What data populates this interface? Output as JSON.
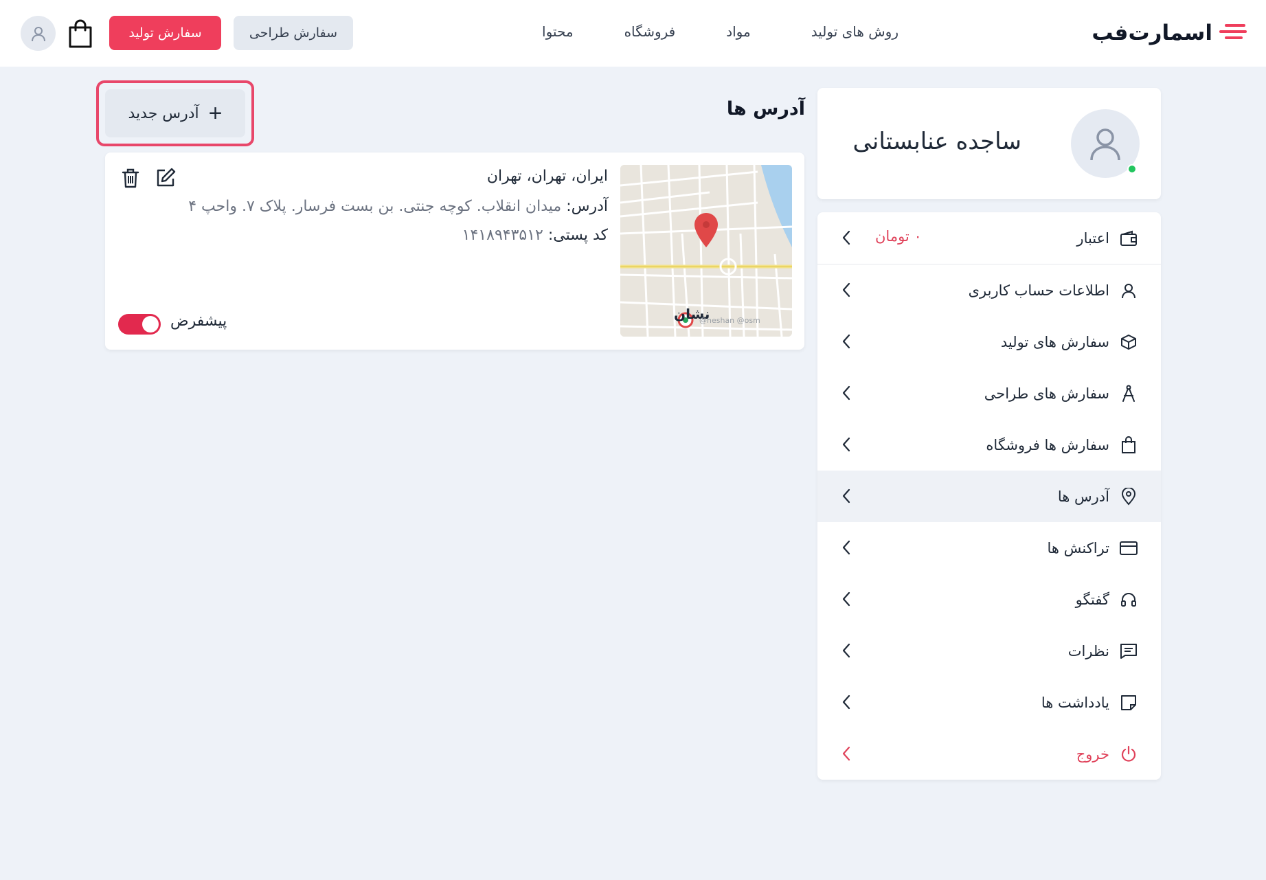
{
  "header": {
    "logo_text": "اسمارت‌فب",
    "nav": [
      "روش های تولید",
      "مواد",
      "فروشگاه",
      "محتوا"
    ],
    "design_order_button": "سفارش طراحی",
    "production_order_button": "سفارش تولید"
  },
  "profile": {
    "name": "ساجده عنابستانی"
  },
  "menu": {
    "credit": {
      "label": "اعتبار",
      "value": "۰ تومان"
    },
    "items": [
      {
        "label": "اطلاعات حساب کاربری",
        "icon": "user-icon"
      },
      {
        "label": "سفارش های تولید",
        "icon": "box-icon"
      },
      {
        "label": "سفارش های طراحی",
        "icon": "compass-icon"
      },
      {
        "label": "سفارش ها فروشگاه",
        "icon": "shopping-bag-icon"
      },
      {
        "label": "آدرس ها",
        "icon": "location-pin-icon"
      },
      {
        "label": "تراکنش ها",
        "icon": "credit-card-icon"
      },
      {
        "label": "گفتگو",
        "icon": "headset-icon"
      },
      {
        "label": "نظرات",
        "icon": "comment-icon"
      },
      {
        "label": "یادداشت ها",
        "icon": "note-icon"
      }
    ],
    "logout": "خروج"
  },
  "main": {
    "title": "آدرس ها",
    "new_address_button": "آدرس جدید",
    "address": {
      "city_line": "ایران، تهران، تهران",
      "address_label": "آدرس:",
      "address_value": "میدان انقلاب. کوچه جنتی. بن بست فرسار. پلاک ۷. واحپ ۴",
      "postal_label": "کد پستی:",
      "postal_value": "۱۴۱۸۹۴۳۵۱۲",
      "default_label": "پیشفرض",
      "map_brand": "نشان",
      "map_credit": "@neshan @osm"
    }
  },
  "colors": {
    "accent": "#ef3e5c",
    "background": "#eef2f8"
  }
}
